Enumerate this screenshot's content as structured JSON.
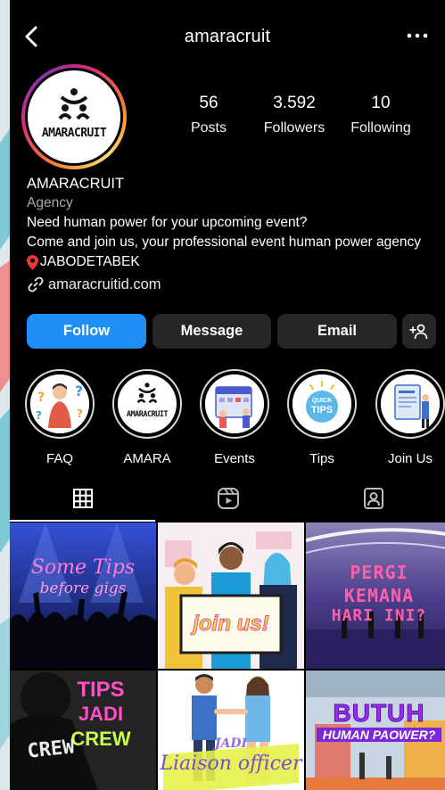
{
  "header": {
    "username": "amaracruit",
    "back_icon": "chevron-left-icon",
    "more_icon": "more-horizontal-icon"
  },
  "profile": {
    "logo_text": "AMARACRUIT",
    "stats": [
      {
        "value": "56",
        "label": "Posts"
      },
      {
        "value": "3.592",
        "label": "Followers"
      },
      {
        "value": "10",
        "label": "Following"
      }
    ],
    "name": "AMARACRUIT",
    "category": "Agency",
    "bio_lines": [
      "Need human power for your upcoming event?",
      "Come and join us, your professional event human power agency"
    ],
    "location": "JABODETABEK",
    "website": "amaracruitid.com"
  },
  "actions": {
    "follow": "Follow",
    "message": "Message",
    "email": "Email",
    "add_user_icon": "add-user-icon"
  },
  "highlights": [
    {
      "label": "FAQ"
    },
    {
      "label": "AMARA",
      "logo_text": "AMARACRUIT"
    },
    {
      "label": "Events"
    },
    {
      "label": "Tips",
      "badge_line1": "QUICK",
      "badge_line2": "TIPS"
    },
    {
      "label": "Join Us"
    }
  ],
  "tabs": [
    {
      "icon": "grid-icon",
      "active": true
    },
    {
      "icon": "reels-icon",
      "active": false
    },
    {
      "icon": "tagged-icon",
      "active": false
    }
  ],
  "posts": [
    {
      "text_line1": "Some Tips",
      "text_line2": "before gigs"
    },
    {
      "text": "join us!"
    },
    {
      "text_line1": "PERGI",
      "text_line2": "KEMANA",
      "text_line3": "HARI INI?"
    },
    {
      "text_line1": "TIPS",
      "text_line2": "JADI",
      "text_line3": "CREW",
      "shirt_text": "CREW"
    },
    {
      "text_line1": "JADI",
      "text_line2": "Liaison officer"
    },
    {
      "text_line1": "BUTUH",
      "text_line2": "HUMAN PAOWER?"
    }
  ],
  "colors": {
    "accent_blue": "#1e90f5",
    "button_dark": "#262626",
    "background": "#000000",
    "location_pin": "#e53935"
  }
}
